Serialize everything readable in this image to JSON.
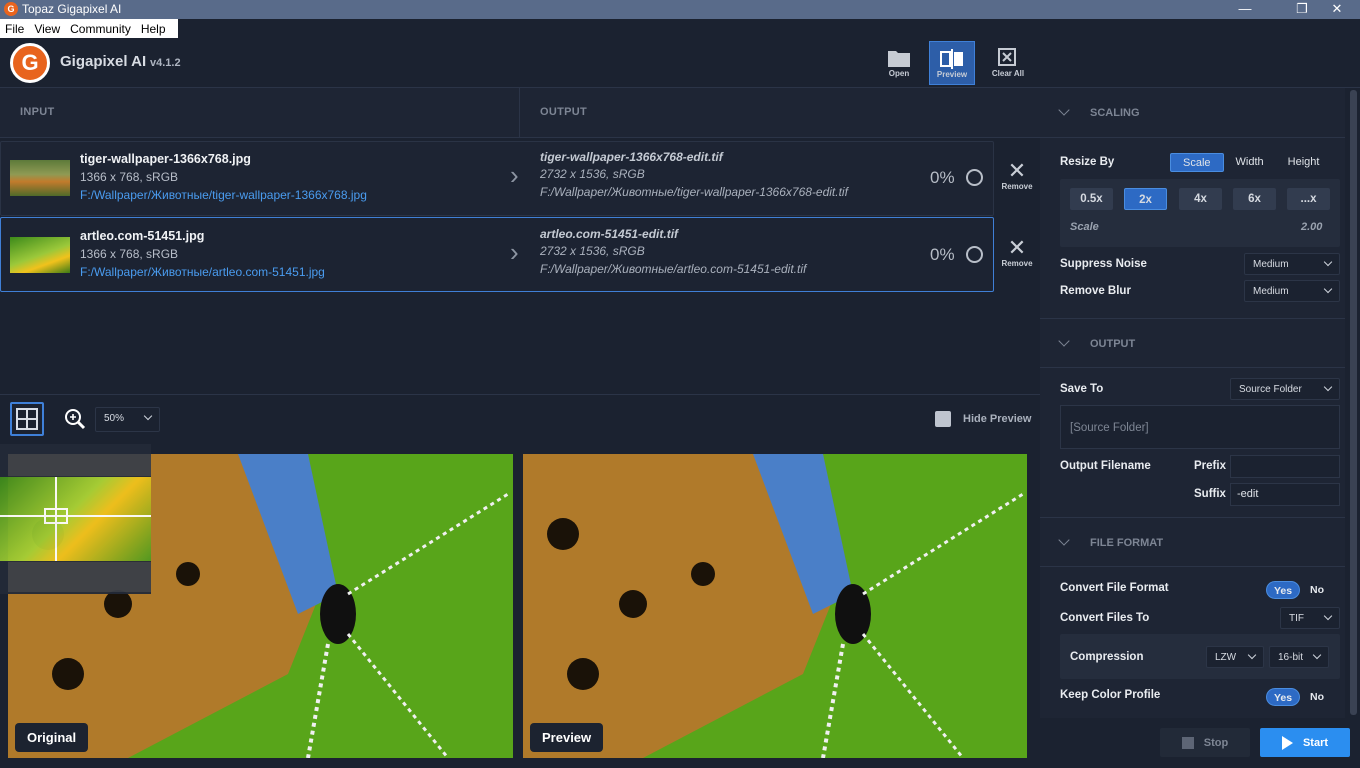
{
  "window": {
    "title": "Topaz Gigapixel AI",
    "minimize": "—",
    "maximize": "❐",
    "close": "✕"
  },
  "menu": [
    "File",
    "View",
    "Community",
    "Help"
  ],
  "app": {
    "name": "Gigapixel AI",
    "version": "v4.1.2",
    "logo_letter": "G"
  },
  "toolbar": {
    "open": "Open",
    "preview": "Preview",
    "clear_all": "Clear All"
  },
  "columns": {
    "input": "INPUT",
    "output": "OUTPUT"
  },
  "files": [
    {
      "name": "tiger-wallpaper-1366x768.jpg",
      "dims": "1366 x 768, sRGB",
      "path": "F:/Wallpaper/Животные/tiger-wallpaper-1366x768.jpg",
      "out_name": "tiger-wallpaper-1366x768-edit.tif",
      "out_dims": "2732 x 1536, sRGB",
      "out_path": "F:/Wallpaper/Животные/tiger-wallpaper-1366x768-edit.tif",
      "progress": "0%",
      "remove": "Remove"
    },
    {
      "name": "artleo.com-51451.jpg",
      "dims": "1366 x 768, sRGB",
      "path": "F:/Wallpaper/Животные/artleo.com-51451.jpg",
      "out_name": "artleo.com-51451-edit.tif",
      "out_dims": "2732 x 1536, sRGB",
      "out_path": "F:/Wallpaper/Животные/artleo.com-51451-edit.tif",
      "progress": "0%",
      "remove": "Remove"
    }
  ],
  "preview": {
    "zoom": "50%",
    "hide_preview": "Hide Preview",
    "original_label": "Original",
    "preview_label": "Preview"
  },
  "scaling": {
    "title": "SCALING",
    "resize_by": "Resize By",
    "modes": [
      "Scale",
      "Width",
      "Height"
    ],
    "scales": [
      "0.5x",
      "2x",
      "4x",
      "6x",
      "...x"
    ],
    "scale_label": "Scale",
    "scale_value": "2.00",
    "suppress_noise": "Suppress Noise",
    "suppress_noise_value": "Medium",
    "remove_blur": "Remove Blur",
    "remove_blur_value": "Medium"
  },
  "output": {
    "title": "OUTPUT",
    "save_to": "Save To",
    "save_to_value": "Source Folder",
    "folder_box": "[Source Folder]",
    "output_filename": "Output Filename",
    "prefix": "Prefix",
    "prefix_value": "",
    "suffix": "Suffix",
    "suffix_value": "-edit"
  },
  "file_format": {
    "title": "FILE FORMAT",
    "convert_format": "Convert File Format",
    "yes": "Yes",
    "no": "No",
    "convert_to": "Convert Files To",
    "convert_to_value": "TIF",
    "compression": "Compression",
    "compression_value": "LZW",
    "bit_depth": "16-bit",
    "keep_profile": "Keep Color Profile"
  },
  "actions": {
    "stop": "Stop",
    "start": "Start"
  },
  "colors": {
    "accent": "#2d6ac4",
    "logo": "#e8641e",
    "link": "#4a9cf0",
    "bg": "#1b2230"
  }
}
